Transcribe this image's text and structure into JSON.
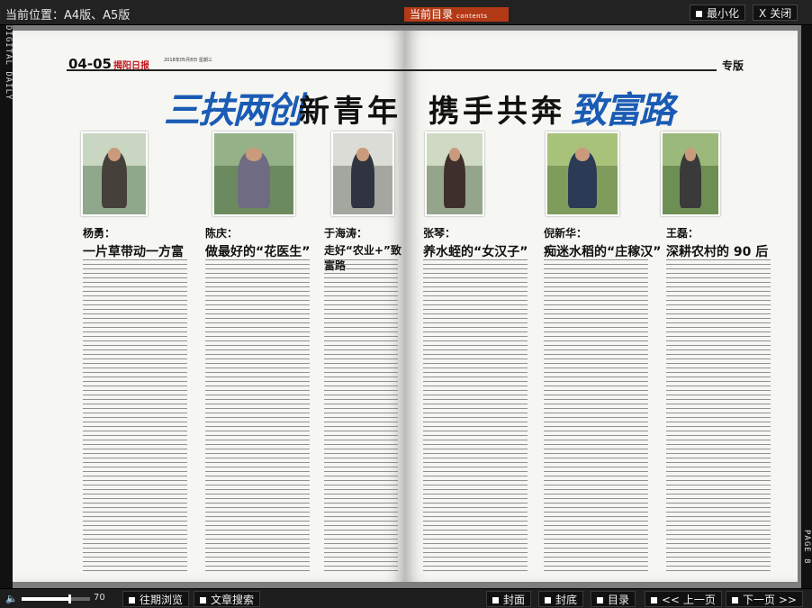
{
  "topbar": {
    "location_label": "当前位置：A4版、A5版",
    "current_dir_label": "当前目录",
    "current_dir_small": "contents",
    "minimize_label": "最小化",
    "close_label": "关闭"
  },
  "sidebar": {
    "vertical_text": "DIGITAL DAILY"
  },
  "right_sidebar": {
    "vertical_text": "PAGE 8"
  },
  "spread": {
    "page_numbers": "04-05",
    "paper_name": "揭阳日报",
    "paper_date": "2018年05月8日 星期三",
    "section": "专版",
    "headline_calli_left": "三扶两创",
    "headline_block_left": "新青年",
    "headline_block_right": "携手共奔",
    "headline_calli_right": "致富路"
  },
  "articles": [
    {
      "name": "杨勇：",
      "title": "一片草带动一方富"
    },
    {
      "name": "陈庆：",
      "title": "做最好的“花医生”"
    },
    {
      "name": "于海涛：",
      "title": "走好“农业+”致富路"
    },
    {
      "name": "张琴：",
      "title": "养水蛭的“女汉子”"
    },
    {
      "name": "倪新华：",
      "title": "痴迷水稻的“庄稼汉”"
    },
    {
      "name": "王磊：",
      "title": "深耕农村的 90 后"
    }
  ],
  "bottombar": {
    "volume_icon": "speaker-icon",
    "volume_value": 70,
    "volume_display": "70",
    "history_label": "往期浏览",
    "search_label": "文章搜索",
    "cover_label": "封面",
    "back_cover_label": "封底",
    "toc_label": "目录",
    "prev_label": "<< 上一页",
    "next_label": "下一页 >>"
  }
}
